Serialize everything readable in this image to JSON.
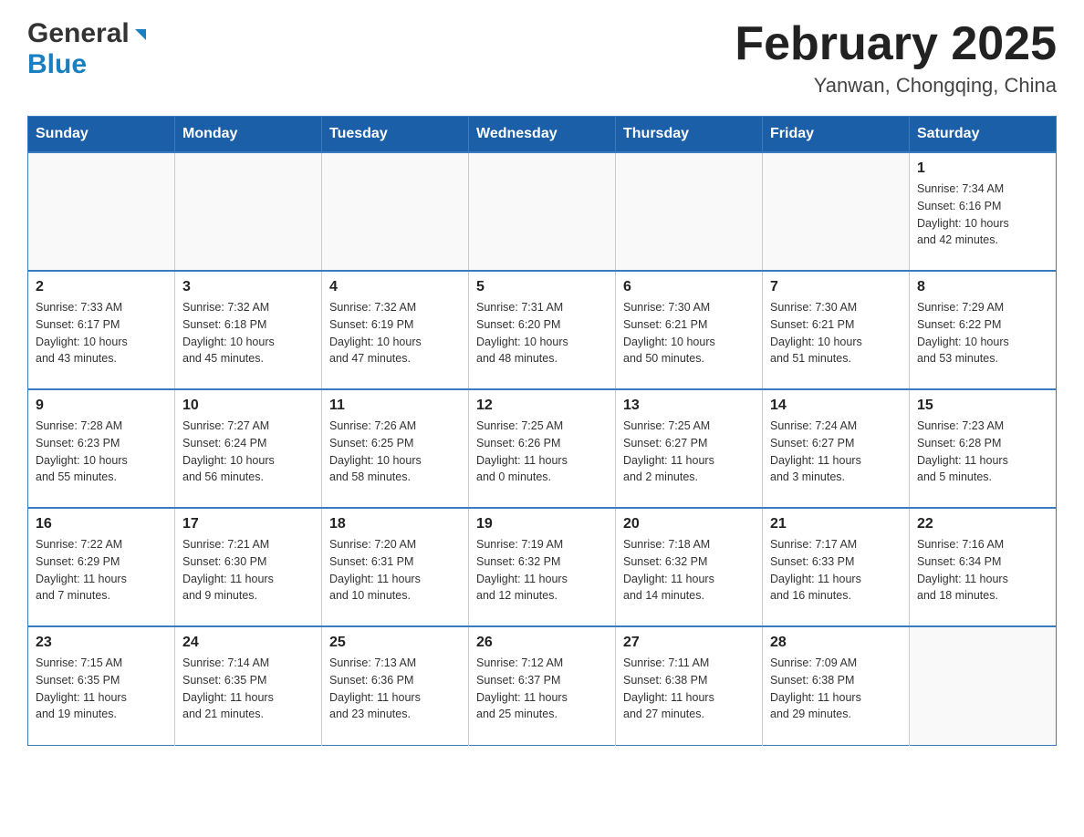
{
  "header": {
    "logo_general": "General",
    "logo_blue": "Blue",
    "title": "February 2025",
    "subtitle": "Yanwan, Chongqing, China"
  },
  "days_of_week": [
    "Sunday",
    "Monday",
    "Tuesday",
    "Wednesday",
    "Thursday",
    "Friday",
    "Saturday"
  ],
  "weeks": [
    [
      {
        "day": "",
        "info": ""
      },
      {
        "day": "",
        "info": ""
      },
      {
        "day": "",
        "info": ""
      },
      {
        "day": "",
        "info": ""
      },
      {
        "day": "",
        "info": ""
      },
      {
        "day": "",
        "info": ""
      },
      {
        "day": "1",
        "info": "Sunrise: 7:34 AM\nSunset: 6:16 PM\nDaylight: 10 hours\nand 42 minutes."
      }
    ],
    [
      {
        "day": "2",
        "info": "Sunrise: 7:33 AM\nSunset: 6:17 PM\nDaylight: 10 hours\nand 43 minutes."
      },
      {
        "day": "3",
        "info": "Sunrise: 7:32 AM\nSunset: 6:18 PM\nDaylight: 10 hours\nand 45 minutes."
      },
      {
        "day": "4",
        "info": "Sunrise: 7:32 AM\nSunset: 6:19 PM\nDaylight: 10 hours\nand 47 minutes."
      },
      {
        "day": "5",
        "info": "Sunrise: 7:31 AM\nSunset: 6:20 PM\nDaylight: 10 hours\nand 48 minutes."
      },
      {
        "day": "6",
        "info": "Sunrise: 7:30 AM\nSunset: 6:21 PM\nDaylight: 10 hours\nand 50 minutes."
      },
      {
        "day": "7",
        "info": "Sunrise: 7:30 AM\nSunset: 6:21 PM\nDaylight: 10 hours\nand 51 minutes."
      },
      {
        "day": "8",
        "info": "Sunrise: 7:29 AM\nSunset: 6:22 PM\nDaylight: 10 hours\nand 53 minutes."
      }
    ],
    [
      {
        "day": "9",
        "info": "Sunrise: 7:28 AM\nSunset: 6:23 PM\nDaylight: 10 hours\nand 55 minutes."
      },
      {
        "day": "10",
        "info": "Sunrise: 7:27 AM\nSunset: 6:24 PM\nDaylight: 10 hours\nand 56 minutes."
      },
      {
        "day": "11",
        "info": "Sunrise: 7:26 AM\nSunset: 6:25 PM\nDaylight: 10 hours\nand 58 minutes."
      },
      {
        "day": "12",
        "info": "Sunrise: 7:25 AM\nSunset: 6:26 PM\nDaylight: 11 hours\nand 0 minutes."
      },
      {
        "day": "13",
        "info": "Sunrise: 7:25 AM\nSunset: 6:27 PM\nDaylight: 11 hours\nand 2 minutes."
      },
      {
        "day": "14",
        "info": "Sunrise: 7:24 AM\nSunset: 6:27 PM\nDaylight: 11 hours\nand 3 minutes."
      },
      {
        "day": "15",
        "info": "Sunrise: 7:23 AM\nSunset: 6:28 PM\nDaylight: 11 hours\nand 5 minutes."
      }
    ],
    [
      {
        "day": "16",
        "info": "Sunrise: 7:22 AM\nSunset: 6:29 PM\nDaylight: 11 hours\nand 7 minutes."
      },
      {
        "day": "17",
        "info": "Sunrise: 7:21 AM\nSunset: 6:30 PM\nDaylight: 11 hours\nand 9 minutes."
      },
      {
        "day": "18",
        "info": "Sunrise: 7:20 AM\nSunset: 6:31 PM\nDaylight: 11 hours\nand 10 minutes."
      },
      {
        "day": "19",
        "info": "Sunrise: 7:19 AM\nSunset: 6:32 PM\nDaylight: 11 hours\nand 12 minutes."
      },
      {
        "day": "20",
        "info": "Sunrise: 7:18 AM\nSunset: 6:32 PM\nDaylight: 11 hours\nand 14 minutes."
      },
      {
        "day": "21",
        "info": "Sunrise: 7:17 AM\nSunset: 6:33 PM\nDaylight: 11 hours\nand 16 minutes."
      },
      {
        "day": "22",
        "info": "Sunrise: 7:16 AM\nSunset: 6:34 PM\nDaylight: 11 hours\nand 18 minutes."
      }
    ],
    [
      {
        "day": "23",
        "info": "Sunrise: 7:15 AM\nSunset: 6:35 PM\nDaylight: 11 hours\nand 19 minutes."
      },
      {
        "day": "24",
        "info": "Sunrise: 7:14 AM\nSunset: 6:35 PM\nDaylight: 11 hours\nand 21 minutes."
      },
      {
        "day": "25",
        "info": "Sunrise: 7:13 AM\nSunset: 6:36 PM\nDaylight: 11 hours\nand 23 minutes."
      },
      {
        "day": "26",
        "info": "Sunrise: 7:12 AM\nSunset: 6:37 PM\nDaylight: 11 hours\nand 25 minutes."
      },
      {
        "day": "27",
        "info": "Sunrise: 7:11 AM\nSunset: 6:38 PM\nDaylight: 11 hours\nand 27 minutes."
      },
      {
        "day": "28",
        "info": "Sunrise: 7:09 AM\nSunset: 6:38 PM\nDaylight: 11 hours\nand 29 minutes."
      },
      {
        "day": "",
        "info": ""
      }
    ]
  ],
  "colors": {
    "header_bg": "#1a5fa8",
    "header_text": "#ffffff",
    "border": "#3a7abf",
    "logo_blue": "#1a7fc1"
  }
}
